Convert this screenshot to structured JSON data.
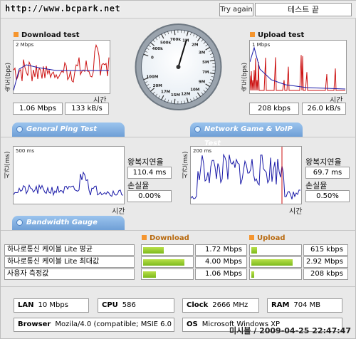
{
  "url": "http://www.bcpark.net",
  "try_again_label": "Try again",
  "status_text": "테스트 끝",
  "download": {
    "title": "Download test",
    "ylabel": "속도(bps)",
    "scale": "2 Mbps",
    "xlabel": "시간",
    "mbps": "1.06 Mbps",
    "kbs": "133 kB/s"
  },
  "upload": {
    "title": "Upload test",
    "ylabel": "속도(bps)",
    "scale": "1 Mbps",
    "xlabel": "시간",
    "kbps": "208 kbps",
    "kbs": "26.0 kB/s"
  },
  "tabs": {
    "ping": "General Ping Test",
    "game": "Network Game & VoIP Test",
    "bandwidth": "Bandwidth Gauge"
  },
  "ping": {
    "ylabel": "시간(ms)",
    "scale": "500 ms",
    "xlabel": "시간",
    "rtt_label": "왕복지연율",
    "rtt_value": "110.4 ms",
    "loss_label": "손실율",
    "loss_value": "0.00%"
  },
  "game": {
    "ylabel": "시간(ms)",
    "scale": "200 ms",
    "xlabel": "시간",
    "rtt_label": "왕복지연율",
    "rtt_value": "69.7 ms",
    "loss_label": "손실율",
    "loss_value": "0.50%"
  },
  "gauge": {
    "ticks": [
      "0",
      "400k",
      "500k",
      "700k",
      "1M",
      "2M",
      "3M",
      "5M",
      "7M",
      "9M",
      "10M",
      "12M",
      "15M",
      "17M",
      "20M",
      "100M"
    ],
    "needle_value_mbps": 1.06
  },
  "bandwidth": {
    "download_header": "Download",
    "upload_header": "Upload",
    "rows": [
      {
        "label": "하나로통신 케이블 Lite 평균",
        "down": "1.72 Mbps",
        "down_fill": 0.43,
        "up": "615 kbps",
        "up_fill": 0.12
      },
      {
        "label": "하나로통신 케이블 Lite 최대값",
        "down": "4.00 Mbps",
        "down_fill": 0.85,
        "up": "2.92 Mbps",
        "up_fill": 0.85
      },
      {
        "label": "사용자 측정값",
        "down": "1.06 Mbps",
        "down_fill": 0.26,
        "up": "208 kbps",
        "up_fill": 0.06
      }
    ]
  },
  "system": {
    "lan_label": "LAN",
    "lan_value": "10 Mbps",
    "cpu_label": "CPU",
    "cpu_value": "586",
    "clock_label": "Clock",
    "clock_value": "2666 MHz",
    "ram_label": "RAM",
    "ram_value": "704 MB",
    "browser_label": "Browser",
    "browser_value": "Mozila/4.0 (compatible; MSIE 6.0",
    "os_label": "OS",
    "os_value": "Microsoft Windows XP"
  },
  "footer": "미시블 / 2009-04-25 22:47:47",
  "colors": {
    "download_line": "#cc1111",
    "upload_line": "#cc1111",
    "avg_line": "#1a1aa8",
    "tab": "#7eaee2",
    "bar": "#8cc63f",
    "marker": "#f5952e"
  }
}
